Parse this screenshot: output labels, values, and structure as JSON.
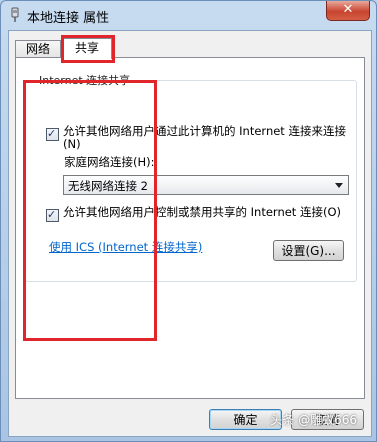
{
  "window": {
    "title": "本地连接 属性",
    "close_label": "✕"
  },
  "tabs": [
    {
      "label": "网络",
      "selected": false
    },
    {
      "label": "共享",
      "selected": true
    }
  ],
  "sharing": {
    "group_title": "Internet 连接共享",
    "allow_connect_label": "允许其他网络用户通过此计算机的 Internet 连接来连接(N)",
    "allow_connect_checked": true,
    "home_network_label": "家庭网络连接(H):",
    "home_network_value": "无线网络连接 2",
    "allow_control_label": "允许其他网络用户控制或禁用共享的 Internet 连接(O)",
    "allow_control_checked": true,
    "ics_link": "使用 ICS (Internet 连接共享)",
    "settings_button": "设置(G)..."
  },
  "buttons": {
    "ok": "确定",
    "cancel": "取消"
  },
  "watermark": "头条 @雕蚁666",
  "colors": {
    "highlight": "#e0262a",
    "link": "#0066cc"
  }
}
